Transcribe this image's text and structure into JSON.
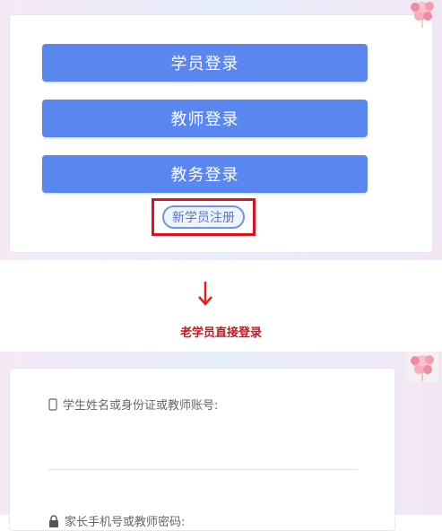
{
  "login_options": {
    "student": "学员登录",
    "teacher": "教师登录",
    "admin": "教务登录",
    "register": "新学员注册"
  },
  "caption": "老学员直接登录",
  "form": {
    "account_label": "学生姓名或身份证或教师账号:",
    "password_label": "家长手机号或教师密码:"
  },
  "colors": {
    "button": "#5a86f0",
    "highlight": "#e0101d",
    "caption": "#c5161d"
  }
}
